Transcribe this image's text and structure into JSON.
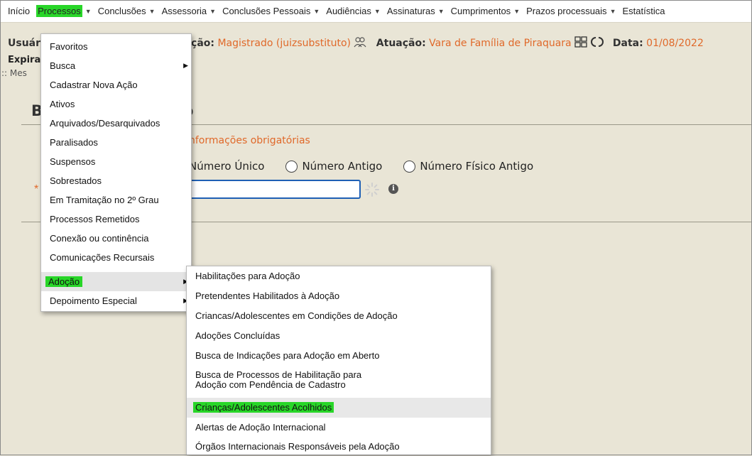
{
  "topmenu": {
    "items": [
      {
        "label": "Início",
        "caret": false
      },
      {
        "label": "Processos",
        "caret": true
      },
      {
        "label": "Conclusões",
        "caret": true
      },
      {
        "label": "Assessoria",
        "caret": true
      },
      {
        "label": "Conclusões Pessoais",
        "caret": true
      },
      {
        "label": "Audiências",
        "caret": true
      },
      {
        "label": "Assinaturas",
        "caret": true
      },
      {
        "label": "Cumprimentos",
        "caret": true
      },
      {
        "label": "Prazos processuais",
        "caret": true
      },
      {
        "label": "Estatística",
        "caret": false
      }
    ]
  },
  "infobar": {
    "user_label": "Usuár",
    "role_label": "ção:",
    "role_value": "Magistrado (juizsubstituto)",
    "atuacao_label": "Atuação:",
    "atuacao_value": "Vara de Família de Piraquara",
    "date_label": "Data:",
    "date_value": "01/08/2022",
    "icons": [
      "users-icon",
      "grid-icon",
      "refresh-icon"
    ]
  },
  "expira_label": "Expira",
  "breadcrumb": ":: Mes",
  "page": {
    "title_left": "B",
    "title_right": "o",
    "required_note": "nformações obrigatórias",
    "radio_options": [
      "Número Único",
      "Número Antigo",
      "Número Físico Antigo"
    ],
    "required_marker": "*",
    "info_glyph": "i"
  },
  "dropdown": {
    "items": [
      {
        "label": "Favoritos",
        "arrow": false,
        "hover": false
      },
      {
        "label": "Busca",
        "arrow": true,
        "hover": false
      },
      {
        "label": "Cadastrar Nova Ação",
        "arrow": false,
        "hover": false
      },
      {
        "label": "Ativos",
        "arrow": false,
        "hover": false
      },
      {
        "label": "Arquivados/Desarquivados",
        "arrow": false,
        "hover": false
      },
      {
        "label": "Paralisados",
        "arrow": false,
        "hover": false
      },
      {
        "label": "Suspensos",
        "arrow": false,
        "hover": false
      },
      {
        "label": "Sobrestados",
        "arrow": false,
        "hover": false
      },
      {
        "label": "Em Tramitação no 2º Grau",
        "arrow": false,
        "hover": false
      },
      {
        "label": "Processos Remetidos",
        "arrow": false,
        "hover": false
      },
      {
        "label": "Conexão ou continência",
        "arrow": false,
        "hover": false
      },
      {
        "label": "Comunicações Recursais",
        "arrow": false,
        "hover": false
      },
      {
        "label": "Adoção",
        "arrow": true,
        "hover": true
      },
      {
        "label": "Depoimento Especial",
        "arrow": true,
        "hover": false
      }
    ]
  },
  "submenu": {
    "items": [
      {
        "label": "Habilitações para Adoção",
        "hover": false
      },
      {
        "label": "Pretendentes Habilitados à Adoção",
        "hover": false
      },
      {
        "label": "Criancas/Adolescentes em Condições de Adoção",
        "hover": false
      },
      {
        "label": "Adoções Concluídas",
        "hover": false
      },
      {
        "label": "Busca de Indicações para Adoção em Aberto",
        "hover": false
      },
      {
        "label": "Busca de Processos de Habilitação para Adoção com Pendência de Cadastro",
        "hover": false
      },
      {
        "label": "Crianças/Adolescentes Acolhidos",
        "hover": true
      },
      {
        "label": "Alertas de Adoção Internacional",
        "hover": false
      },
      {
        "label": "Órgãos Internacionais Responsáveis pela Adoção",
        "hover": false
      }
    ]
  },
  "colors": {
    "accent": "#e0692a",
    "highlight": "#28d628",
    "background": "#e9e5d6",
    "input_border": "#1e5fb5"
  }
}
